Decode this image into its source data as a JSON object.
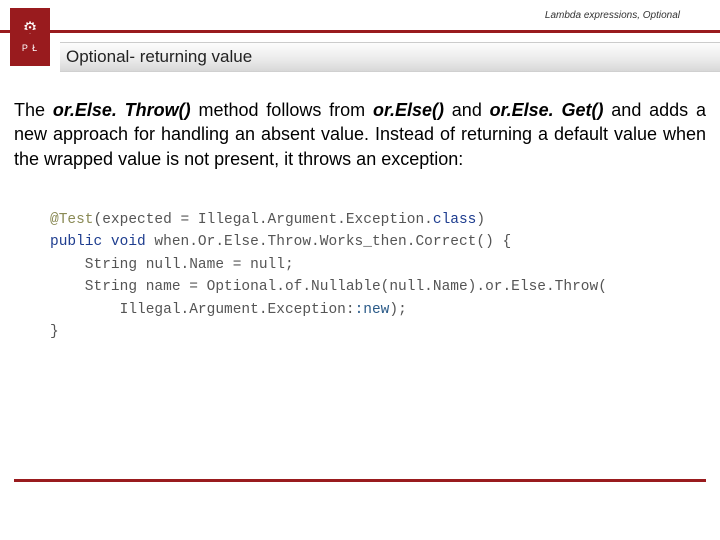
{
  "header": {
    "breadcrumb": "Lambda expressions, Optional",
    "logo_text": "P   Ł",
    "title": "Optional- returning value"
  },
  "paragraph": {
    "pre1": "The ",
    "m1": "or.Else. Throw()",
    "mid1": " method follows from ",
    "m2": "or.Else()",
    "mid2": " and ",
    "m3": "or.Else. Get()",
    "post": " and adds a new approach for handling an absent value. Instead of returning a default value when the wrapped value is not present, it throws an exception:"
  },
  "code": {
    "l1a": "@Test",
    "l1b": "(expected = Illegal.Argument.Exception.",
    "l1c": "class",
    "l1d": ")",
    "l2a": "public void",
    "l2b": " when.Or.Else.Throw.Works_then.Correct() {",
    "l3": "    String null.Name = null;",
    "l4": "    String name = Optional.of.Nullable(null.Name).or.Else.Throw(",
    "l5a": "        Illegal.Argument.Exception:",
    "l5b": ":new",
    "l5c": ");",
    "l6": "}"
  }
}
